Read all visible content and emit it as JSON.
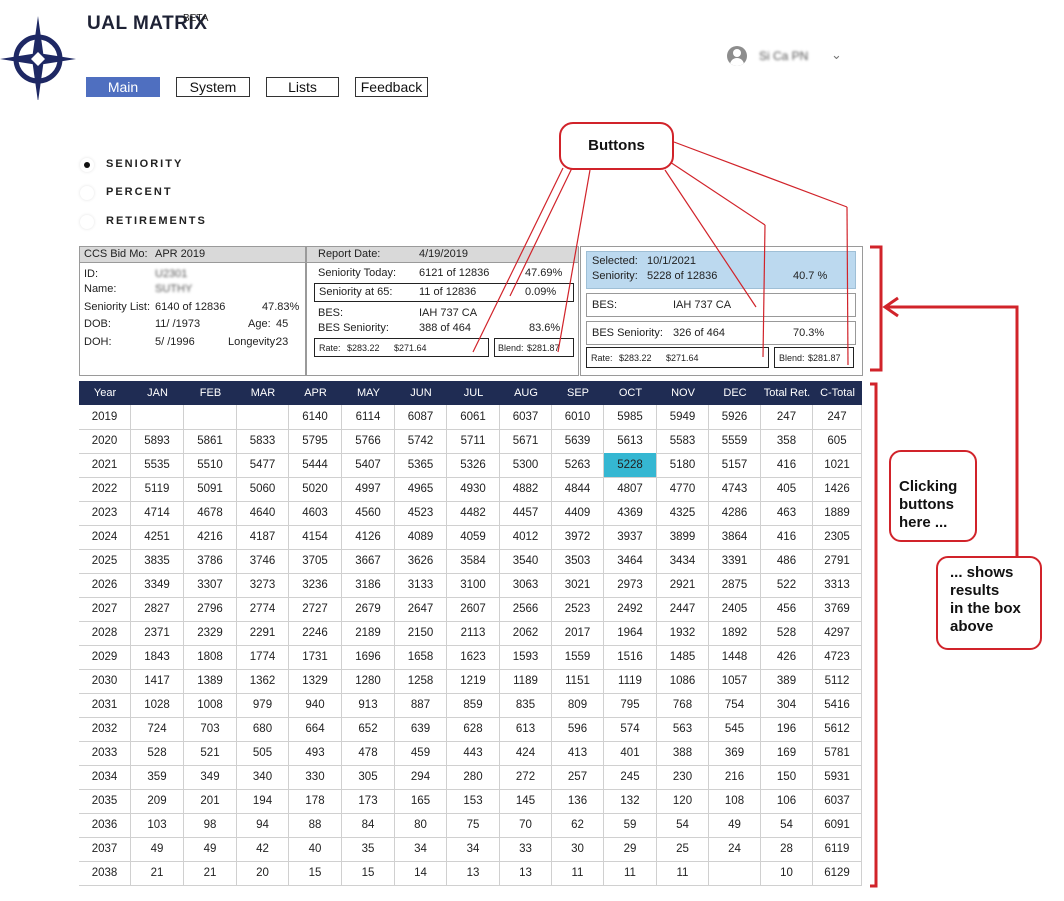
{
  "app": {
    "title": "UAL MATRIX",
    "badge": "BETA"
  },
  "nav": [
    "Main",
    "System",
    "Lists",
    "Feedback"
  ],
  "user": {
    "name": "Si Ca PN"
  },
  "views": [
    {
      "label": "SENIORITY",
      "selected": true
    },
    {
      "label": "PERCENT",
      "selected": false
    },
    {
      "label": "RETIREMENTS",
      "selected": false
    }
  ],
  "bid_panel": {
    "header_label": "CCS Bid Mo:",
    "header_value": "APR 2019",
    "id_label": "ID:",
    "id_value": "U2301",
    "name_label": "Name:",
    "name_value": "SUTHY",
    "list_label": "Seniority List:",
    "list_value": "6140 of 12836",
    "list_pct": "47.83%",
    "dob_label": "DOB:",
    "dob_value": "11/ /1973",
    "age_label": "Age:",
    "age_value": "45",
    "doh_label": "DOH:",
    "doh_value": "5/ /1996",
    "long_label": "Longevity:",
    "long_value": "23"
  },
  "report_panel": {
    "header_label": "Report Date:",
    "header_value": "4/19/2019",
    "today_label": "Seniority Today:",
    "today_value": "6121 of 12836",
    "today_pct": "47.69%",
    "at65_label": "Seniority at 65:",
    "at65_value": "11 of 12836",
    "at65_pct": "0.09%",
    "bes_label": "BES:",
    "bes_value": "IAH 737 CA",
    "bess_label": "BES Seniority:",
    "bess_value": "388 of 464",
    "bess_pct": "83.6%",
    "rate_label": "Rate:",
    "rate_1": "$283.22",
    "rate_2": "$271.64",
    "blend_label": "Blend:",
    "blend_value": "$281.87"
  },
  "selected_panel": {
    "sel_label": "Selected:",
    "sel_value": "10/1/2021",
    "sen_label": "Seniority:",
    "sen_value": "5228 of 12836",
    "sen_pct": "40.7 %",
    "bes_label": "BES:",
    "bes_value": "IAH 737 CA",
    "bess_label": "BES Seniority:",
    "bess_value": "326 of 464",
    "bess_pct": "70.3%",
    "rate_label": "Rate:",
    "rate_1": "$283.22",
    "rate_2": "$271.64",
    "blend_label": "Blend:",
    "blend_value": "$281.87"
  },
  "table": {
    "columns": [
      "Year",
      "JAN",
      "FEB",
      "MAR",
      "APR",
      "MAY",
      "JUN",
      "JUL",
      "AUG",
      "SEP",
      "OCT",
      "NOV",
      "DEC",
      "Total Ret.",
      "C-Total"
    ],
    "highlight": {
      "row": 2,
      "col": 10
    },
    "rows": [
      [
        "2019",
        "",
        "",
        "",
        "6140",
        "6114",
        "6087",
        "6061",
        "6037",
        "6010",
        "5985",
        "5949",
        "5926",
        "247",
        "247"
      ],
      [
        "2020",
        "5893",
        "5861",
        "5833",
        "5795",
        "5766",
        "5742",
        "5711",
        "5671",
        "5639",
        "5613",
        "5583",
        "5559",
        "358",
        "605"
      ],
      [
        "2021",
        "5535",
        "5510",
        "5477",
        "5444",
        "5407",
        "5365",
        "5326",
        "5300",
        "5263",
        "5228",
        "5180",
        "5157",
        "416",
        "1021"
      ],
      [
        "2022",
        "5119",
        "5091",
        "5060",
        "5020",
        "4997",
        "4965",
        "4930",
        "4882",
        "4844",
        "4807",
        "4770",
        "4743",
        "405",
        "1426"
      ],
      [
        "2023",
        "4714",
        "4678",
        "4640",
        "4603",
        "4560",
        "4523",
        "4482",
        "4457",
        "4409",
        "4369",
        "4325",
        "4286",
        "463",
        "1889"
      ],
      [
        "2024",
        "4251",
        "4216",
        "4187",
        "4154",
        "4126",
        "4089",
        "4059",
        "4012",
        "3972",
        "3937",
        "3899",
        "3864",
        "416",
        "2305"
      ],
      [
        "2025",
        "3835",
        "3786",
        "3746",
        "3705",
        "3667",
        "3626",
        "3584",
        "3540",
        "3503",
        "3464",
        "3434",
        "3391",
        "486",
        "2791"
      ],
      [
        "2026",
        "3349",
        "3307",
        "3273",
        "3236",
        "3186",
        "3133",
        "3100",
        "3063",
        "3021",
        "2973",
        "2921",
        "2875",
        "522",
        "3313"
      ],
      [
        "2027",
        "2827",
        "2796",
        "2774",
        "2727",
        "2679",
        "2647",
        "2607",
        "2566",
        "2523",
        "2492",
        "2447",
        "2405",
        "456",
        "3769"
      ],
      [
        "2028",
        "2371",
        "2329",
        "2291",
        "2246",
        "2189",
        "2150",
        "2113",
        "2062",
        "2017",
        "1964",
        "1932",
        "1892",
        "528",
        "4297"
      ],
      [
        "2029",
        "1843",
        "1808",
        "1774",
        "1731",
        "1696",
        "1658",
        "1623",
        "1593",
        "1559",
        "1516",
        "1485",
        "1448",
        "426",
        "4723"
      ],
      [
        "2030",
        "1417",
        "1389",
        "1362",
        "1329",
        "1280",
        "1258",
        "1219",
        "1189",
        "1151",
        "1119",
        "1086",
        "1057",
        "389",
        "5112"
      ],
      [
        "2031",
        "1028",
        "1008",
        "979",
        "940",
        "913",
        "887",
        "859",
        "835",
        "809",
        "795",
        "768",
        "754",
        "304",
        "5416"
      ],
      [
        "2032",
        "724",
        "703",
        "680",
        "664",
        "652",
        "639",
        "628",
        "613",
        "596",
        "574",
        "563",
        "545",
        "196",
        "5612"
      ],
      [
        "2033",
        "528",
        "521",
        "505",
        "493",
        "478",
        "459",
        "443",
        "424",
        "413",
        "401",
        "388",
        "369",
        "169",
        "5781"
      ],
      [
        "2034",
        "359",
        "349",
        "340",
        "330",
        "305",
        "294",
        "280",
        "272",
        "257",
        "245",
        "230",
        "216",
        "150",
        "5931"
      ],
      [
        "2035",
        "209",
        "201",
        "194",
        "178",
        "173",
        "165",
        "153",
        "145",
        "136",
        "132",
        "120",
        "108",
        "106",
        "6037"
      ],
      [
        "2036",
        "103",
        "98",
        "94",
        "88",
        "84",
        "80",
        "75",
        "70",
        "62",
        "59",
        "54",
        "49",
        "54",
        "6091"
      ],
      [
        "2037",
        "49",
        "49",
        "42",
        "40",
        "35",
        "34",
        "34",
        "33",
        "30",
        "29",
        "25",
        "24",
        "28",
        "6119"
      ],
      [
        "2038",
        "21",
        "21",
        "20",
        "15",
        "15",
        "14",
        "13",
        "13",
        "11",
        "11",
        "11",
        "",
        "10",
        "6129"
      ]
    ]
  },
  "annotations": {
    "buttons": "Buttons",
    "clicking": [
      "Clicking",
      "buttons",
      "here ..."
    ],
    "shows": [
      "... shows",
      "results",
      "in the box",
      "above"
    ]
  },
  "colors": {
    "accent": "#4f6fc0",
    "header_bg": "#1f2c53",
    "highlight": "#35b7d2",
    "annotation": "#d1232a",
    "selected_bg": "#bcd9ef"
  }
}
